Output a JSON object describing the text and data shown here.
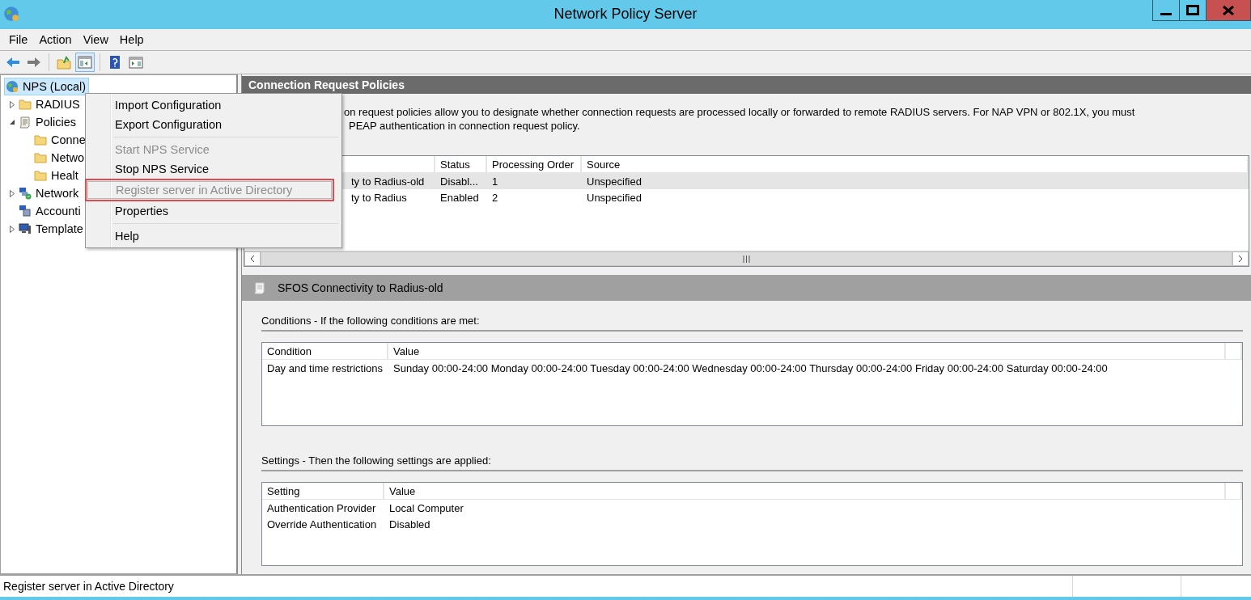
{
  "window": {
    "title": "Network Policy Server"
  },
  "menu_bar": [
    "File",
    "Action",
    "View",
    "Help"
  ],
  "toolbar": [
    {
      "kind": "back",
      "pressed": false
    },
    {
      "kind": "forward",
      "pressed": false
    },
    {
      "kind": "up",
      "pressed": false
    },
    {
      "kind": "tree",
      "pressed": true
    },
    {
      "kind": "help",
      "pressed": false
    },
    {
      "kind": "pane",
      "pressed": false
    }
  ],
  "tree": [
    {
      "label": "NPS (Local)",
      "kind": "globe",
      "selected": true,
      "children": [
        {
          "label": "RADIUS",
          "kind": "folder",
          "expanded": false,
          "selected": false
        },
        {
          "label": "Policies",
          "kind": "scroll",
          "expanded": true,
          "selected": false,
          "children": [
            {
              "label": "Conne",
              "kind": "folder",
              "selected": false
            },
            {
              "label": "Netwo",
              "kind": "folder",
              "selected": false
            },
            {
              "label": "Healt",
              "kind": "folder",
              "selected": false
            }
          ]
        },
        {
          "label": "Network",
          "kind": "network",
          "expanded": false,
          "selected": false
        },
        {
          "label": "Accounti",
          "kind": "computers",
          "selected": false
        },
        {
          "label": "Template",
          "kind": "monitor",
          "expanded": false,
          "selected": false
        }
      ]
    }
  ],
  "context_menu": [
    {
      "kind": "item",
      "label": "Import Configuration",
      "disabled": false,
      "highlighted": false
    },
    {
      "kind": "item",
      "label": "Export Configuration",
      "disabled": false,
      "highlighted": false
    },
    {
      "kind": "separator"
    },
    {
      "kind": "item",
      "label": "Start NPS Service",
      "disabled": true,
      "highlighted": false
    },
    {
      "kind": "item",
      "label": "Stop NPS Service",
      "disabled": false,
      "highlighted": false
    },
    {
      "kind": "item",
      "label": "Register server in Active Directory",
      "disabled": true,
      "highlighted": true
    },
    {
      "kind": "item",
      "label": "Properties",
      "disabled": false,
      "highlighted": false
    },
    {
      "kind": "separator"
    },
    {
      "kind": "item",
      "label": "Help",
      "disabled": false,
      "highlighted": false
    }
  ],
  "panel": {
    "title": "Connection Request Policies",
    "description": [
      "on request policies allow you to designate whether connection requests are processed locally or forwarded to remote RADIUS servers. For NAP VPN or 802.1X, you must",
      "PEAP authentication in connection request policy."
    ],
    "policies": {
      "columns": [
        "",
        "Status",
        "Processing Order",
        "Source"
      ],
      "rows": [
        {
          "cells": [
            "ty to Radius-old",
            "Disabl...",
            "1",
            "Unspecified"
          ],
          "selected": true
        },
        {
          "cells": [
            "ty to Radius",
            "Enabled",
            "2",
            "Unspecified"
          ],
          "selected": false
        }
      ]
    }
  },
  "details": {
    "title": "SFOS Connectivity to Radius-old",
    "conditions": {
      "label": "Conditions - If the following conditions are met:",
      "columns": [
        "Condition",
        "Value"
      ],
      "rows": [
        [
          "Day and time restrictions",
          "Sunday 00:00-24:00 Monday 00:00-24:00 Tuesday 00:00-24:00 Wednesday 00:00-24:00 Thursday 00:00-24:00 Friday 00:00-24:00 Saturday 00:00-24:00"
        ]
      ]
    },
    "settings": {
      "label": "Settings - Then the following settings are applied:",
      "columns": [
        "Setting",
        "Value"
      ],
      "rows": [
        [
          "Authentication Provider",
          "Local Computer"
        ],
        [
          "Override Authentication",
          "Disabled"
        ]
      ]
    }
  },
  "status_bar": "Register server in Active Directory"
}
